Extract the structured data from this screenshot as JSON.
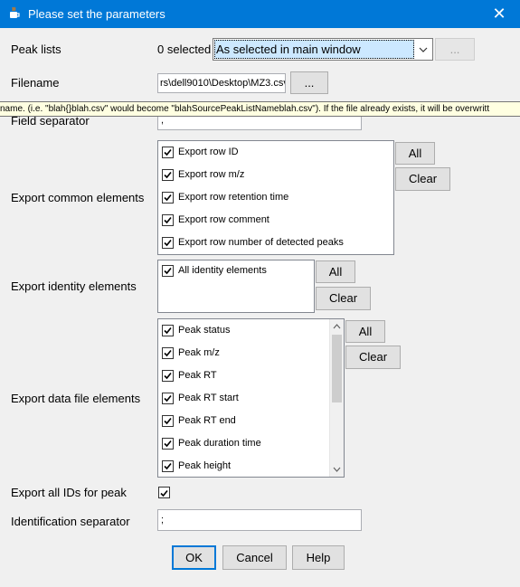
{
  "window": {
    "title": "Please set the parameters",
    "icon": "java-cup-icon",
    "close_glyph": "✕"
  },
  "peak_lists": {
    "label": "Peak lists",
    "selected_count": "0 selected",
    "dropdown_value": "As selected in main window",
    "more_button": "..."
  },
  "filename": {
    "label": "Filename",
    "value": "rs\\dell9010\\Desktop\\MZ3.csv",
    "browse_button": "..."
  },
  "tooltip": {
    "text": "name. (i.e. \"blah{}blah.csv\" would become \"blahSourcePeakListNameblah.csv\"). If the file already exists, it will be overwritt"
  },
  "field_separator": {
    "label": "Field separator",
    "value": ","
  },
  "common_elements": {
    "label": "Export common elements",
    "items": [
      {
        "label": "Export row ID",
        "checked": true
      },
      {
        "label": "Export row m/z",
        "checked": true
      },
      {
        "label": "Export row retention time",
        "checked": true
      },
      {
        "label": "Export row comment",
        "checked": true
      },
      {
        "label": "Export row number of detected peaks",
        "checked": true
      }
    ],
    "all_button": "All",
    "clear_button": "Clear"
  },
  "identity_elements": {
    "label": "Export identity elements",
    "items": [
      {
        "label": "All identity elements",
        "checked": true
      }
    ],
    "all_button": "All",
    "clear_button": "Clear"
  },
  "data_file_elements": {
    "label": "Export data file elements",
    "items": [
      {
        "label": "Peak status",
        "checked": true
      },
      {
        "label": "Peak m/z",
        "checked": true
      },
      {
        "label": "Peak RT",
        "checked": true
      },
      {
        "label": "Peak RT start",
        "checked": true
      },
      {
        "label": "Peak RT end",
        "checked": true
      },
      {
        "label": "Peak duration time",
        "checked": true
      },
      {
        "label": "Peak height",
        "checked": true
      }
    ],
    "all_button": "All",
    "clear_button": "Clear"
  },
  "export_all_ids": {
    "label": "Export all IDs for peak",
    "checked": true
  },
  "identification_separator": {
    "label": "Identification separator",
    "value": ";"
  },
  "footer": {
    "ok": "OK",
    "cancel": "Cancel",
    "help": "Help"
  }
}
